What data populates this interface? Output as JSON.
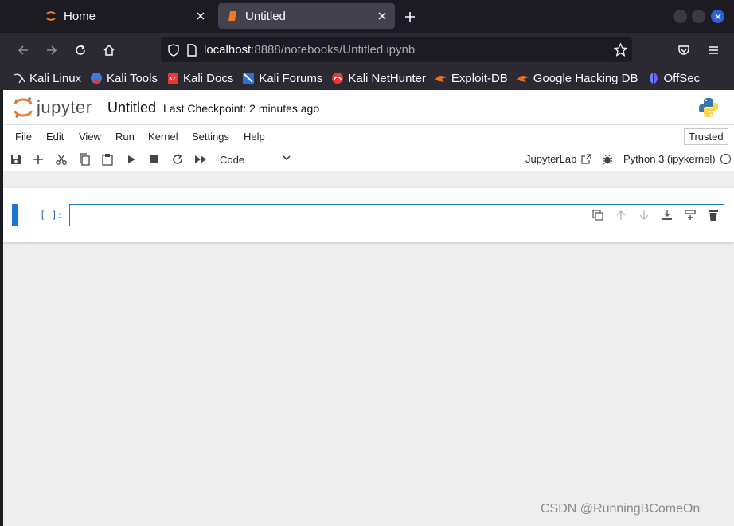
{
  "browser": {
    "tabs": [
      {
        "title": "Home",
        "icon": "jupyter-orange-icon"
      },
      {
        "title": "Untitled",
        "icon": "notebook-orange-icon"
      }
    ],
    "url_host": "localhost",
    "url_rest": ":8888/notebooks/Untitled.ipynb",
    "bookmarks": [
      {
        "label": "Kali Linux",
        "icon": "kali-dragon-icon"
      },
      {
        "label": "Kali Tools",
        "icon": "kali-tools-icon"
      },
      {
        "label": "Kali Docs",
        "icon": "kali-docs-icon"
      },
      {
        "label": "Kali Forums",
        "icon": "kali-forums-icon"
      },
      {
        "label": "Kali NetHunter",
        "icon": "nethunter-icon"
      },
      {
        "label": "Exploit-DB",
        "icon": "exploit-db-icon"
      },
      {
        "label": "Google Hacking DB",
        "icon": "ghdb-icon"
      },
      {
        "label": "OffSec",
        "icon": "offsec-icon"
      }
    ]
  },
  "jupyter": {
    "wordmark": "jupyter",
    "notebook_title": "Untitled",
    "checkpoint": "Last Checkpoint: 2 minutes ago",
    "menu": [
      "File",
      "Edit",
      "View",
      "Run",
      "Kernel",
      "Settings",
      "Help"
    ],
    "trusted": "Trusted",
    "cell_type": "Code",
    "jupyterlab_link": "JupyterLab",
    "kernel_name": "Python 3 (ipykernel)",
    "cell_prompt": "[ ]:"
  },
  "watermark": "CSDN @RunningBComeOn",
  "colors": {
    "accent": "#1976d2",
    "jupyter_orange": "#f37726",
    "page_bg": "#eeeeee"
  }
}
